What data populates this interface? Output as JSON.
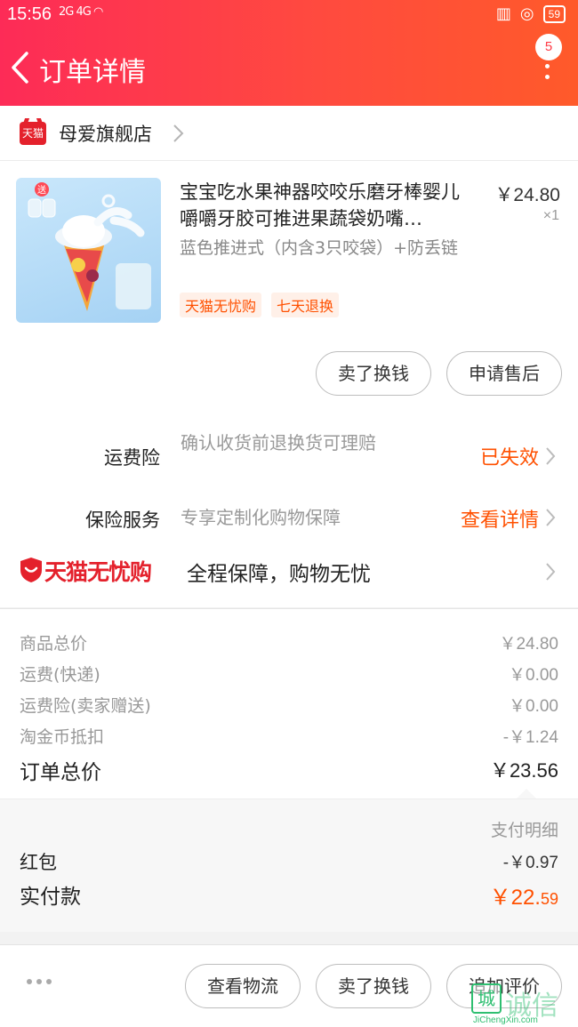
{
  "status_bar": {
    "time": "15:56",
    "network": "2G 4G",
    "battery": "59"
  },
  "header": {
    "title": "订单详情",
    "badge_count": "5"
  },
  "shop": {
    "logo_text": "天猫",
    "name": "母爱旗舰店"
  },
  "product": {
    "image_tag": "送",
    "title": "宝宝吃水果神器咬咬乐磨牙棒婴儿嚼嚼牙胶可推进果蔬袋奶嘴…",
    "price": "￥24.80",
    "quantity": "×1",
    "sku": "蓝色推进式（内含3只咬袋）+防丢链",
    "tags": [
      "天猫无忧购",
      "七天退换"
    ]
  },
  "product_actions": {
    "sell_label": "卖了换钱",
    "aftersale_label": "申请售后"
  },
  "insurance": {
    "freight": {
      "label": "运费险",
      "desc": "确认收货前退换货可理赔",
      "status": "已失效"
    },
    "service": {
      "label": "保险服务",
      "desc": "专享定制化购物保障",
      "status": "查看详情"
    }
  },
  "wuyou": {
    "logo": "天猫无忧购",
    "text": "全程保障，购物无忧"
  },
  "prices": {
    "rows": [
      {
        "label": "商品总价",
        "value": "￥24.80"
      },
      {
        "label": "运费(快递)",
        "value": "￥0.00"
      },
      {
        "label": "运费险(卖家赠送)",
        "value": "￥0.00"
      },
      {
        "label": "淘金币抵扣",
        "value": "-￥1.24"
      }
    ],
    "total_label": "订单总价",
    "total_value": "￥23.56"
  },
  "payment": {
    "detail_label": "支付明细",
    "hongbao_label": "红包",
    "hongbao_value": "-￥0.97",
    "paid_label": "实付款",
    "paid_value_main": "￥22.",
    "paid_value_cents": "59"
  },
  "bottom_bar": {
    "logistics_label": "查看物流",
    "sell_label": "卖了换钱",
    "review_label": "追加评价"
  },
  "watermark": {
    "box_char": "城",
    "name": "诚信",
    "url": "JiChengXin.com"
  },
  "colors": {
    "header_gradient_start": "#fd2b57",
    "header_gradient_end": "#ff5a2a",
    "accent_orange": "#ff5000",
    "tmall_red": "#e4212c"
  }
}
